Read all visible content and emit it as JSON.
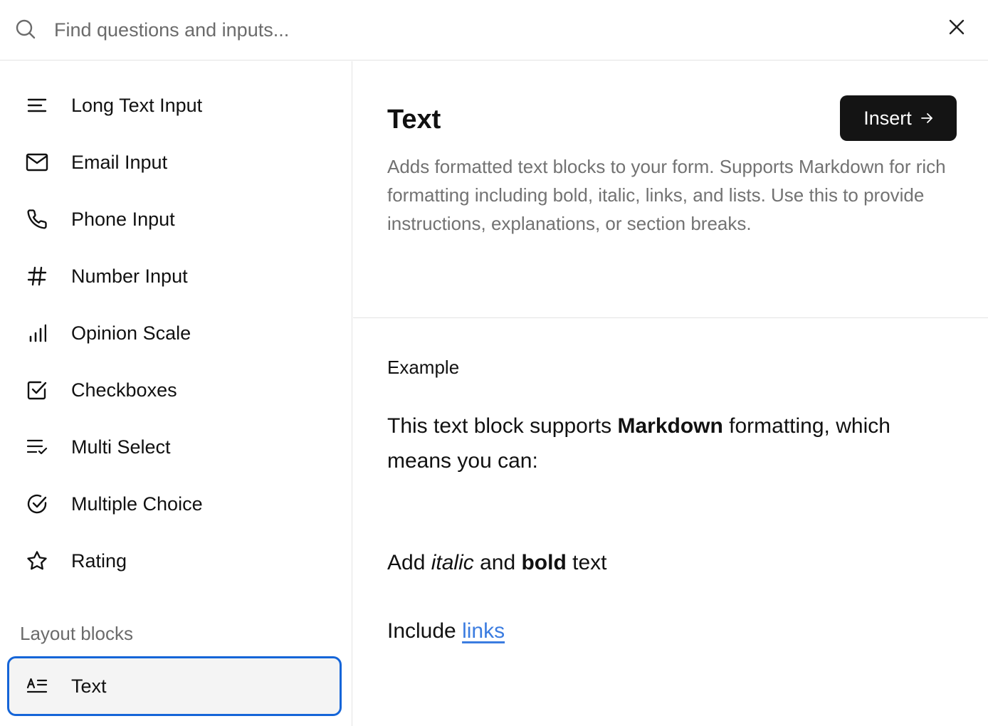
{
  "search": {
    "placeholder": "Find questions and inputs..."
  },
  "sidebar": {
    "items": [
      {
        "label": "Long Text Input",
        "icon": "text-lines-icon"
      },
      {
        "label": "Email Input",
        "icon": "envelope-icon"
      },
      {
        "label": "Phone Input",
        "icon": "phone-icon"
      },
      {
        "label": "Number Input",
        "icon": "hash-icon"
      },
      {
        "label": "Opinion Scale",
        "icon": "bar-chart-icon"
      },
      {
        "label": "Checkboxes",
        "icon": "checkbox-icon"
      },
      {
        "label": "Multi Select",
        "icon": "list-check-icon"
      },
      {
        "label": "Multiple Choice",
        "icon": "circle-check-icon"
      },
      {
        "label": "Rating",
        "icon": "star-icon"
      }
    ],
    "layout_heading": "Layout blocks",
    "layout_items": [
      {
        "label": "Text",
        "icon": "text-block-icon",
        "selected": true
      }
    ]
  },
  "detail": {
    "title": "Text",
    "insert_label": "Insert",
    "description": "Adds formatted text blocks to your form. Supports Markdown for rich formatting including bold, italic, links, and lists. Use this to provide instructions, explanations, or section breaks.",
    "example_label": "Example",
    "example": {
      "p1_before": "This text block supports ",
      "p1_bold": "Markdown",
      "p1_after": " formatting, which means you can:",
      "p2_before": "Add ",
      "p2_italic": "italic",
      "p2_middle": " and ",
      "p2_bold": "bold",
      "p2_after": " text",
      "p3_before": "Include ",
      "p3_link": "links"
    }
  },
  "colors": {
    "accent": "#1565d8",
    "link": "#3b7ce0",
    "button_bg": "#141414",
    "muted_text": "#727272"
  }
}
